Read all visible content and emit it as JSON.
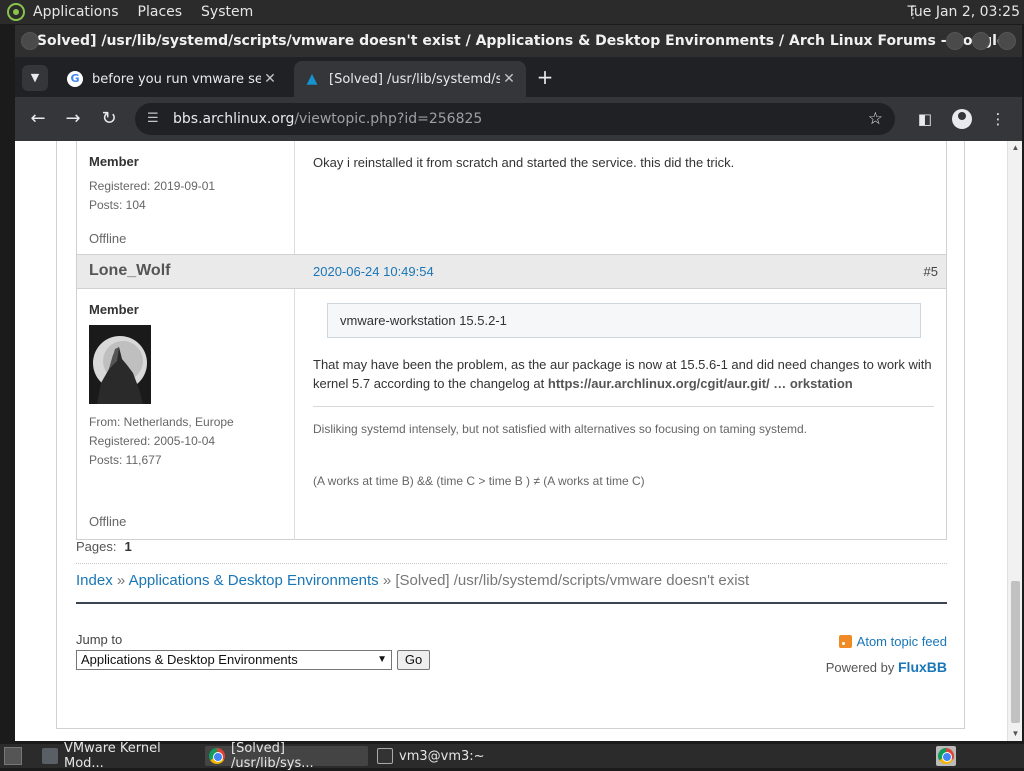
{
  "panel": {
    "menus": [
      "Applications",
      "Places",
      "System"
    ],
    "clock": "Tue Jan  2, 03:25"
  },
  "window": {
    "title": "[Solved] /usr/lib/systemd/scripts/vmware doesn't exist / Applications & Desktop Environments / Arch Linux Forums - Google Chrome"
  },
  "tabs": [
    {
      "title": "before you run vmware sever",
      "favicon": "google-icon"
    },
    {
      "title": "[Solved] /usr/lib/systemd/scri",
      "favicon": "arch-linux-icon"
    }
  ],
  "omnibox": {
    "domain": "bbs.archlinux.org",
    "path": "/viewtopic.php?id=256825"
  },
  "post4": {
    "rank": "Member",
    "registered": "Registered: 2019-09-01",
    "posts": "Posts: 104",
    "status": "Offline",
    "message": "Okay i reinstalled it from scratch and started the service. this did the trick."
  },
  "post5": {
    "author": "Lone_Wolf",
    "date": "2020-06-24 10:49:54",
    "number": "#5",
    "rank": "Member",
    "from": "From: Netherlands, Europe",
    "registered": "Registered: 2005-10-04",
    "posts": "Posts: 11,677",
    "status": "Offline",
    "quote": "vmware-workstation 15.5.2-1",
    "message_line1": "That may have been the problem, as the aur package is now at 15.5.6-1 and did need changes to work with",
    "message_line2_prefix": "kernel 5.7  according to the changelog at ",
    "message_link": "https://aur.archlinux.org/cgit/aur.git/ … orkstation",
    "signature_line1": "Disliking systemd intensely, but not satisfied with alternatives so focusing on taming systemd.",
    "signature_line2": "(A works at time B)  && (time C > time B ) ≠  (A works at time C)"
  },
  "pagination": {
    "label": "Pages:",
    "current": "1"
  },
  "breadcrumb": {
    "index": "Index",
    "sep1": "»",
    "forum": "Applications & Desktop Environments",
    "sep2": "»",
    "topic": "[Solved] /usr/lib/systemd/scripts/vmware doesn't exist"
  },
  "footer": {
    "jump_label": "Jump to",
    "jump_selected": "Applications & Desktop Environments",
    "go_label": "Go",
    "feed_label": "Atom topic feed",
    "powered_prefix": "Powered by",
    "powered_brand": "FluxBB"
  },
  "taskbar": {
    "items": [
      {
        "label": "VMware Kernel Mod...",
        "icon": "vmware-icon"
      },
      {
        "label": "[Solved] /usr/lib/sys...",
        "icon": "chrome-icon"
      },
      {
        "label": "vm3@vm3:~",
        "icon": "terminal-icon"
      }
    ]
  },
  "colors": {
    "link": "#1a76b7",
    "post_header_bg": "#eaeaea",
    "chrome_dark": "#35363a"
  }
}
